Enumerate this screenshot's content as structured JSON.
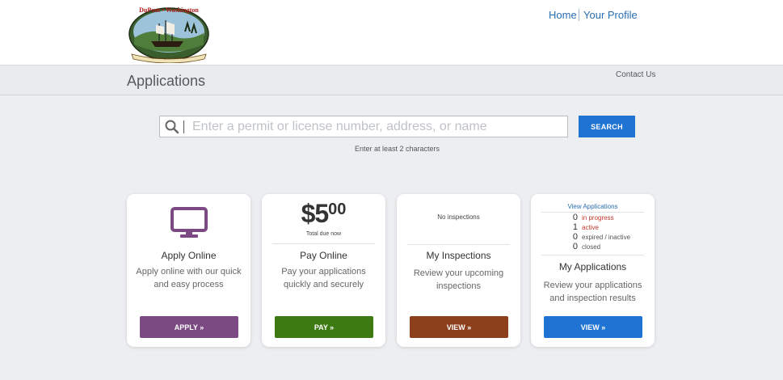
{
  "header": {
    "logo_text_top": "DuPont • Washington",
    "logo_banner": "Welcoming for 5,000 Years",
    "nav": {
      "home": "Home",
      "profile": "Your Profile"
    }
  },
  "subheader": {
    "title": "Applications",
    "contact": "Contact Us"
  },
  "search": {
    "placeholder": "Enter a permit or license number, address, or name",
    "button": "SEARCH",
    "hint": "Enter at least 2 characters"
  },
  "cards": {
    "apply": {
      "title": "Apply Online",
      "desc": "Apply online with our quick and easy process",
      "button": "APPLY »",
      "color": "#7b4a82"
    },
    "pay": {
      "price_dollar": "$5",
      "price_cents": "00",
      "price_sub": "Total due now",
      "title": "Pay Online",
      "desc": "Pay your applications quickly and securely",
      "button": "PAY »",
      "color": "#3e7a12"
    },
    "inspections": {
      "note": "No inspections",
      "title": "My Inspections",
      "desc": "Review your upcoming inspections",
      "button": "VIEW »",
      "color": "#8b3f1b"
    },
    "applications": {
      "link": "View Applications",
      "stats": [
        {
          "count": "0",
          "label": "in progress"
        },
        {
          "count": "1",
          "label": "active"
        },
        {
          "count": "0",
          "label": "expired / inactive"
        },
        {
          "count": "0",
          "label": "closed"
        }
      ],
      "title": "My Applications",
      "desc": "Review your applications and inspection results",
      "button": "VIEW »",
      "color": "#1f73d2"
    }
  }
}
